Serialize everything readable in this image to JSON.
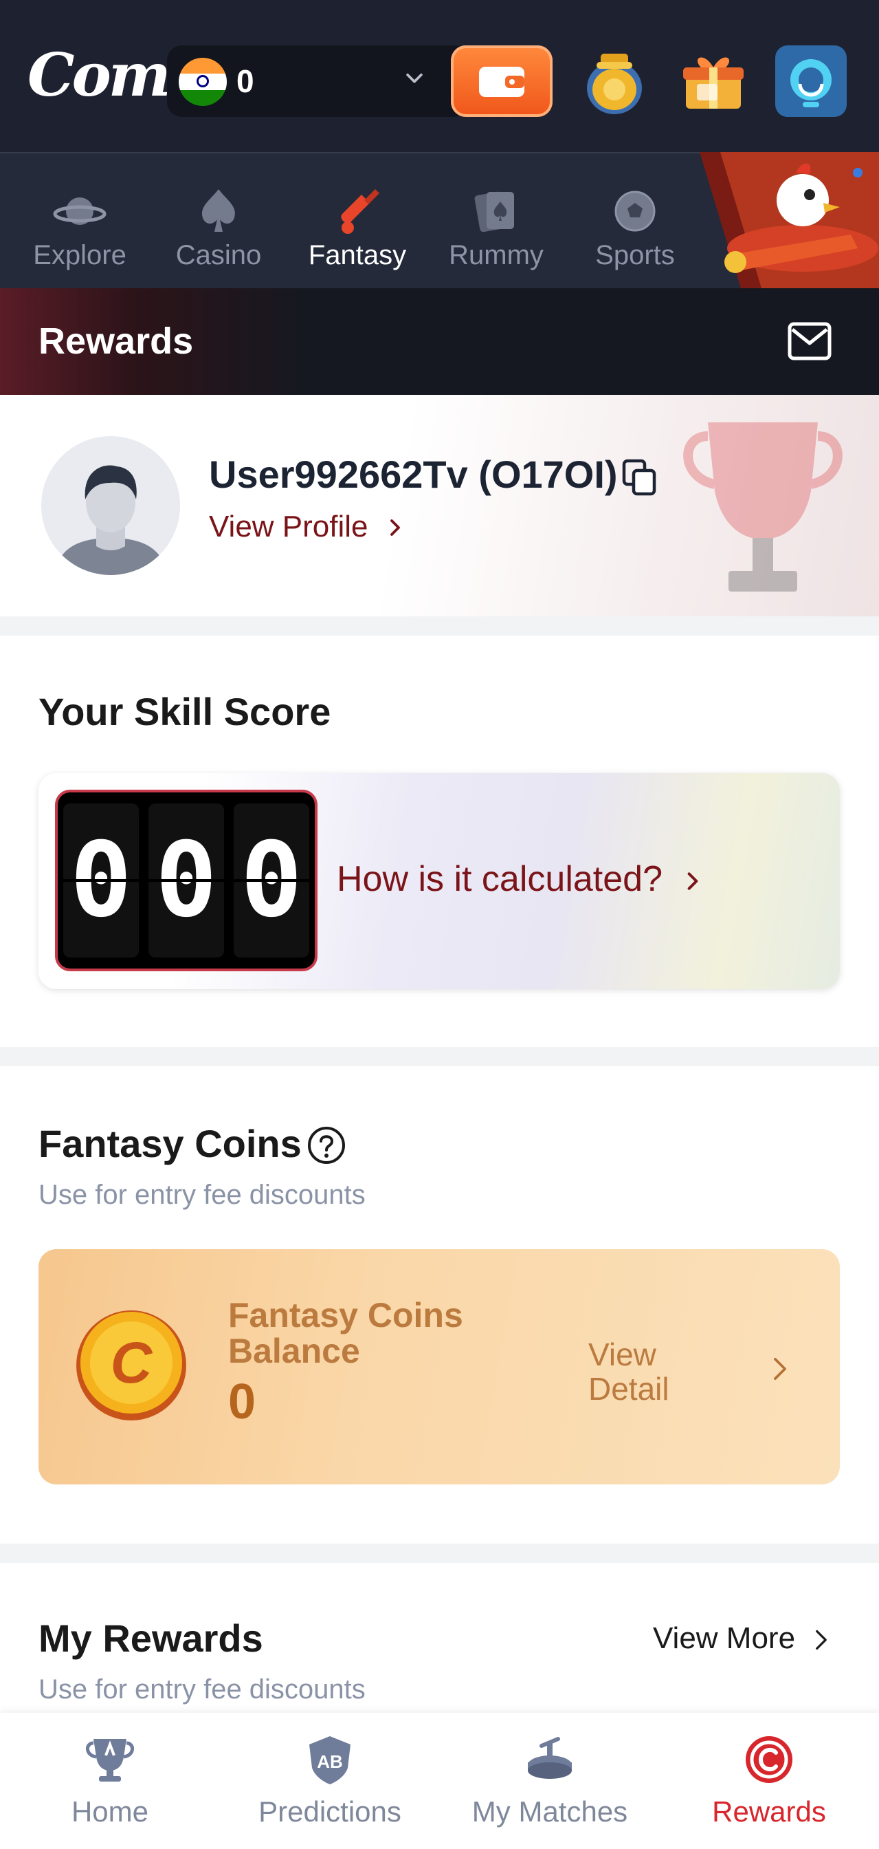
{
  "header": {
    "logo_text": "Come",
    "balance": "0",
    "country": "India"
  },
  "categories": [
    {
      "label": "Explore",
      "icon": "planet-icon",
      "active": false
    },
    {
      "label": "Casino",
      "icon": "spade-icon",
      "active": false
    },
    {
      "label": "Fantasy",
      "icon": "cricket-bat-icon",
      "active": true
    },
    {
      "label": "Rummy",
      "icon": "cards-icon",
      "active": false
    },
    {
      "label": "Sports",
      "icon": "football-icon",
      "active": false
    }
  ],
  "page": {
    "title": "Rewards"
  },
  "profile": {
    "username": "User992662Tv (O17OI)",
    "view_profile": "View Profile"
  },
  "skill": {
    "title": "Your Skill Score",
    "digits": [
      "0",
      "0",
      "0"
    ],
    "calc_link": "How is it calculated?"
  },
  "coins": {
    "title": "Fantasy Coins",
    "subtitle": "Use for entry fee discounts",
    "balance_label": "Fantasy Coins Balance",
    "balance": "0",
    "view_detail": "View Detail",
    "coin_letter": "C"
  },
  "my_rewards": {
    "title": "My Rewards",
    "subtitle": "Use for entry fee discounts",
    "view_more": "View More"
  },
  "bottom_nav": [
    {
      "label": "Home",
      "icon": "trophy-icon",
      "active": false
    },
    {
      "label": "Predictions",
      "icon": "ab-shield-icon",
      "active": false
    },
    {
      "label": "My Matches",
      "icon": "matches-icon",
      "active": false
    },
    {
      "label": "Rewards",
      "icon": "rewards-coin-icon",
      "active": true
    }
  ],
  "colors": {
    "accent": "#7a1418",
    "active_tab": "#d7262c",
    "topbar": "#1e2230",
    "wallet": "#f0561a"
  }
}
